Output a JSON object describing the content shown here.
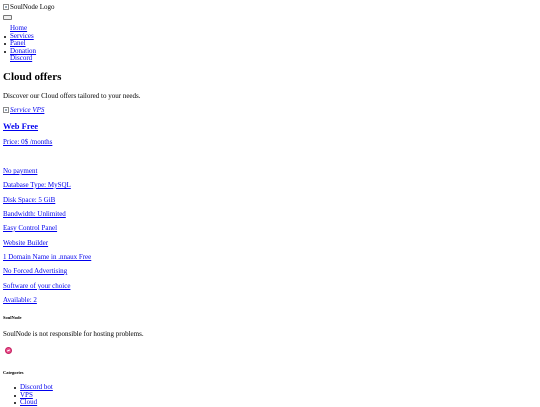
{
  "header": {
    "logo_alt": "SoulNode Logo",
    "nav": [
      "Home",
      "Services",
      "Panel",
      "Donation",
      "Discord"
    ]
  },
  "main": {
    "title": "Cloud offers",
    "description": "Discover our Cloud offers tailored to your needs.",
    "service_image_alt": "Service VPS",
    "plan_name": "Web Free",
    "price": "Price: 0$ /months",
    "features": [
      "No payment",
      "Database Type: MySQL",
      "Disk Space: 5 GiB",
      "Bandwidth: Unlimited",
      "Easy Control Panel",
      "Website Builder",
      "1 Domain Name in .nnaux Free",
      "No Forced Advertising",
      "Software of your choice",
      "Available: 2"
    ]
  },
  "footer": {
    "brand": "SoulNode",
    "disclaimer": "SoulNode is not responsible for hosting problems.",
    "social_icon": "dribbble-icon",
    "categories_title": "Categories",
    "categories": [
      "Discord bot",
      "VPS",
      "Cloud"
    ]
  }
}
